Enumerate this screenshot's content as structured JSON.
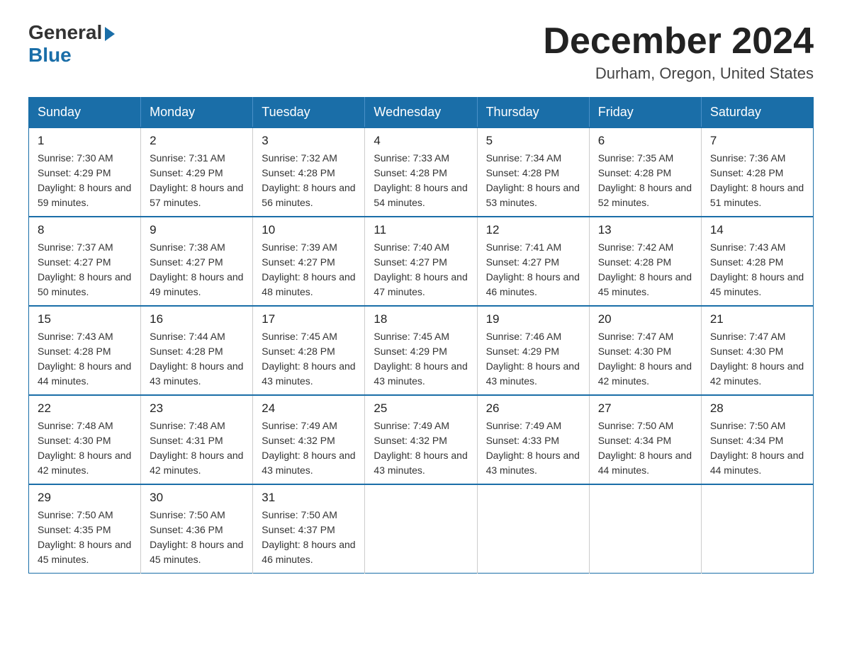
{
  "logo": {
    "general": "General",
    "blue": "Blue"
  },
  "title": "December 2024",
  "location": "Durham, Oregon, United States",
  "days_of_week": [
    "Sunday",
    "Monday",
    "Tuesday",
    "Wednesday",
    "Thursday",
    "Friday",
    "Saturday"
  ],
  "weeks": [
    [
      {
        "day": "1",
        "sunrise": "7:30 AM",
        "sunset": "4:29 PM",
        "daylight": "8 hours and 59 minutes."
      },
      {
        "day": "2",
        "sunrise": "7:31 AM",
        "sunset": "4:29 PM",
        "daylight": "8 hours and 57 minutes."
      },
      {
        "day": "3",
        "sunrise": "7:32 AM",
        "sunset": "4:28 PM",
        "daylight": "8 hours and 56 minutes."
      },
      {
        "day": "4",
        "sunrise": "7:33 AM",
        "sunset": "4:28 PM",
        "daylight": "8 hours and 54 minutes."
      },
      {
        "day": "5",
        "sunrise": "7:34 AM",
        "sunset": "4:28 PM",
        "daylight": "8 hours and 53 minutes."
      },
      {
        "day": "6",
        "sunrise": "7:35 AM",
        "sunset": "4:28 PM",
        "daylight": "8 hours and 52 minutes."
      },
      {
        "day": "7",
        "sunrise": "7:36 AM",
        "sunset": "4:28 PM",
        "daylight": "8 hours and 51 minutes."
      }
    ],
    [
      {
        "day": "8",
        "sunrise": "7:37 AM",
        "sunset": "4:27 PM",
        "daylight": "8 hours and 50 minutes."
      },
      {
        "day": "9",
        "sunrise": "7:38 AM",
        "sunset": "4:27 PM",
        "daylight": "8 hours and 49 minutes."
      },
      {
        "day": "10",
        "sunrise": "7:39 AM",
        "sunset": "4:27 PM",
        "daylight": "8 hours and 48 minutes."
      },
      {
        "day": "11",
        "sunrise": "7:40 AM",
        "sunset": "4:27 PM",
        "daylight": "8 hours and 47 minutes."
      },
      {
        "day": "12",
        "sunrise": "7:41 AM",
        "sunset": "4:27 PM",
        "daylight": "8 hours and 46 minutes."
      },
      {
        "day": "13",
        "sunrise": "7:42 AM",
        "sunset": "4:28 PM",
        "daylight": "8 hours and 45 minutes."
      },
      {
        "day": "14",
        "sunrise": "7:43 AM",
        "sunset": "4:28 PM",
        "daylight": "8 hours and 45 minutes."
      }
    ],
    [
      {
        "day": "15",
        "sunrise": "7:43 AM",
        "sunset": "4:28 PM",
        "daylight": "8 hours and 44 minutes."
      },
      {
        "day": "16",
        "sunrise": "7:44 AM",
        "sunset": "4:28 PM",
        "daylight": "8 hours and 43 minutes."
      },
      {
        "day": "17",
        "sunrise": "7:45 AM",
        "sunset": "4:28 PM",
        "daylight": "8 hours and 43 minutes."
      },
      {
        "day": "18",
        "sunrise": "7:45 AM",
        "sunset": "4:29 PM",
        "daylight": "8 hours and 43 minutes."
      },
      {
        "day": "19",
        "sunrise": "7:46 AM",
        "sunset": "4:29 PM",
        "daylight": "8 hours and 43 minutes."
      },
      {
        "day": "20",
        "sunrise": "7:47 AM",
        "sunset": "4:30 PM",
        "daylight": "8 hours and 42 minutes."
      },
      {
        "day": "21",
        "sunrise": "7:47 AM",
        "sunset": "4:30 PM",
        "daylight": "8 hours and 42 minutes."
      }
    ],
    [
      {
        "day": "22",
        "sunrise": "7:48 AM",
        "sunset": "4:30 PM",
        "daylight": "8 hours and 42 minutes."
      },
      {
        "day": "23",
        "sunrise": "7:48 AM",
        "sunset": "4:31 PM",
        "daylight": "8 hours and 42 minutes."
      },
      {
        "day": "24",
        "sunrise": "7:49 AM",
        "sunset": "4:32 PM",
        "daylight": "8 hours and 43 minutes."
      },
      {
        "day": "25",
        "sunrise": "7:49 AM",
        "sunset": "4:32 PM",
        "daylight": "8 hours and 43 minutes."
      },
      {
        "day": "26",
        "sunrise": "7:49 AM",
        "sunset": "4:33 PM",
        "daylight": "8 hours and 43 minutes."
      },
      {
        "day": "27",
        "sunrise": "7:50 AM",
        "sunset": "4:34 PM",
        "daylight": "8 hours and 44 minutes."
      },
      {
        "day": "28",
        "sunrise": "7:50 AM",
        "sunset": "4:34 PM",
        "daylight": "8 hours and 44 minutes."
      }
    ],
    [
      {
        "day": "29",
        "sunrise": "7:50 AM",
        "sunset": "4:35 PM",
        "daylight": "8 hours and 45 minutes."
      },
      {
        "day": "30",
        "sunrise": "7:50 AM",
        "sunset": "4:36 PM",
        "daylight": "8 hours and 45 minutes."
      },
      {
        "day": "31",
        "sunrise": "7:50 AM",
        "sunset": "4:37 PM",
        "daylight": "8 hours and 46 minutes."
      },
      null,
      null,
      null,
      null
    ]
  ],
  "labels": {
    "sunrise": "Sunrise:",
    "sunset": "Sunset:",
    "daylight": "Daylight:"
  }
}
